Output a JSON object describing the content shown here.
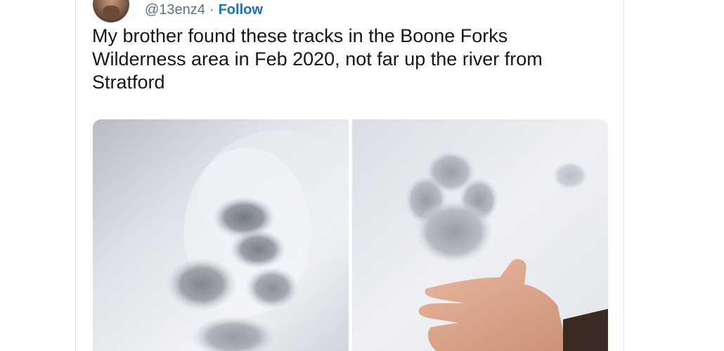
{
  "tweet": {
    "handle": "@13enz4",
    "separator": "·",
    "follow_label": "Follow",
    "text": "My brother found these tracks in the Boone Forks Wilderness area in Feb 2020, not far up the river from Stratford"
  },
  "media": {
    "photos": [
      {
        "subject": "animal track in snow close-up"
      },
      {
        "subject": "animal track in snow with hand for scale"
      }
    ]
  },
  "colors": {
    "link": "#1b6fc4",
    "secondary_text": "#5b7083",
    "primary_text": "#14171a",
    "card_border": "#dcdfe3"
  }
}
